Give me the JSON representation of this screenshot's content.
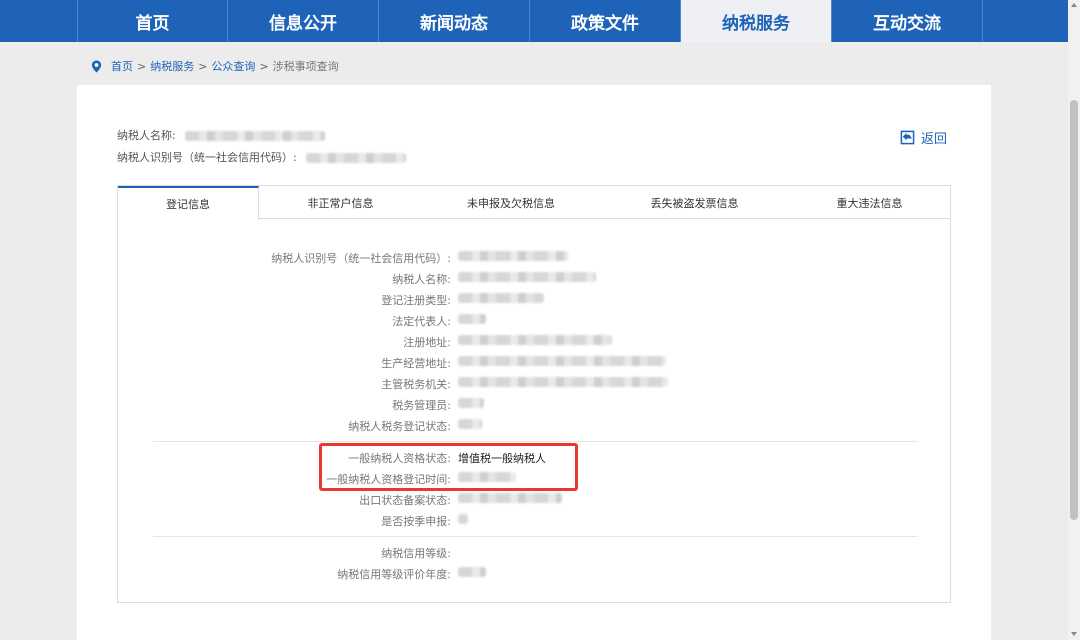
{
  "nav": {
    "tabs": [
      {
        "label": "首页"
      },
      {
        "label": "信息公开"
      },
      {
        "label": "新闻动态"
      },
      {
        "label": "政策文件"
      },
      {
        "label": "纳税服务"
      },
      {
        "label": "互动交流"
      }
    ],
    "active_index": 4
  },
  "breadcrumb": {
    "home": "首页",
    "sep": ">",
    "level1": "纳税服务",
    "level2": "公众查询",
    "current": "涉税事项查询"
  },
  "header": {
    "taxpayer_name_label": "纳税人名称:",
    "taxpayer_id_label": "纳税人识别号（统一社会信用代码）:",
    "back_label": "返回"
  },
  "tabs": [
    {
      "label": "登记信息"
    },
    {
      "label": "非正常户信息"
    },
    {
      "label": "未申报及欠税信息"
    },
    {
      "label": "丢失被盗发票信息"
    },
    {
      "label": "重大违法信息"
    }
  ],
  "fields": {
    "tax_id": {
      "label": "纳税人识别号（统一社会信用代码）:"
    },
    "name": {
      "label": "纳税人名称:"
    },
    "reg_type": {
      "label": "登记注册类型:"
    },
    "legal_rep": {
      "label": "法定代表人:"
    },
    "reg_address": {
      "label": "注册地址:"
    },
    "biz_address": {
      "label": "生产经营地址:"
    },
    "tax_authority": {
      "label": "主管税务机关:"
    },
    "tax_officer": {
      "label": "税务管理员:"
    },
    "reg_status": {
      "label": "纳税人税务登记状态:"
    },
    "general_status": {
      "label": "一般纳税人资格状态:",
      "value": "增值税一般纳税人"
    },
    "general_reg_time": {
      "label": "一般纳税人资格登记时间:"
    },
    "export_status": {
      "label": "出口状态备案状态:"
    },
    "quarterly": {
      "label": "是否按季申报:"
    },
    "credit_grade": {
      "label": "纳税信用等级:"
    },
    "credit_year": {
      "label": "纳税信用等级评价年度:"
    }
  },
  "colors": {
    "nav_blue": "#1f63b8",
    "highlight_red": "#e8382f"
  },
  "icons": {
    "breadcrumb": "location-pin-icon",
    "back": "back-arrow-icon"
  }
}
